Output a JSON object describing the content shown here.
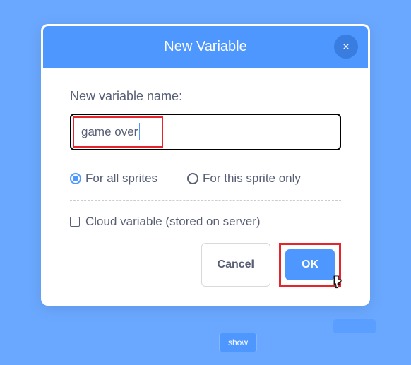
{
  "bg": {
    "show": "show"
  },
  "modal": {
    "title": "New Variable",
    "label": "New variable name:",
    "input_value": "game over",
    "radio": {
      "all_sprites": "For all sprites",
      "this_sprite": "For this sprite only"
    },
    "cloud_label": "Cloud variable (stored on server)",
    "cancel": "Cancel",
    "ok": "OK"
  },
  "colors": {
    "primary": "#4d97ff",
    "highlight": "#e6242c",
    "text": "#575e75"
  }
}
